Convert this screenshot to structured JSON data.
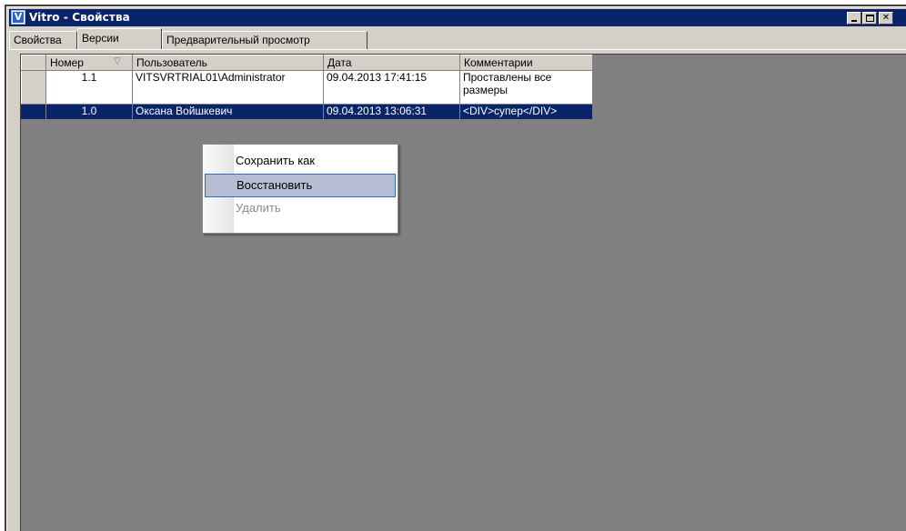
{
  "window": {
    "title": "Vitro - Свойства",
    "icon_letter": "V",
    "icon": "app-icon",
    "buttons": [
      "minimize",
      "maximize",
      "close"
    ]
  },
  "tabs": [
    {
      "label": "Свойства",
      "active": false
    },
    {
      "label": "Версии",
      "active": true
    },
    {
      "label": "Предварительный просмотр",
      "active": false
    }
  ],
  "grid": {
    "columns": [
      "Номер",
      "Пользователь",
      "Дата",
      "Комментарии"
    ],
    "sort_column": "Номер",
    "rows": [
      {
        "number": "1.1",
        "user": "VITSVRTRIAL01\\Administrator",
        "date": "09.04.2013 17:41:15",
        "comment_line1": "Проставлены все",
        "comment_line2": "размеры"
      },
      {
        "number": "1.0",
        "user": "Оксана Войшкевич",
        "date": "09.04.2013 13:06:31",
        "comment_line1": "<DIV>супер</DIV>",
        "selected": true
      }
    ]
  },
  "context_menu": {
    "items": [
      {
        "label": "Сохранить как",
        "enabled": true
      },
      {
        "label": "Восстановить",
        "enabled": true,
        "highlighted": true
      },
      {
        "label": "Удалить",
        "enabled": false
      }
    ]
  },
  "colors": {
    "titlebar": "#0a246a",
    "selection": "#0a246a",
    "workspace": "#808080",
    "menu_highlight": "#b6bdd2"
  }
}
